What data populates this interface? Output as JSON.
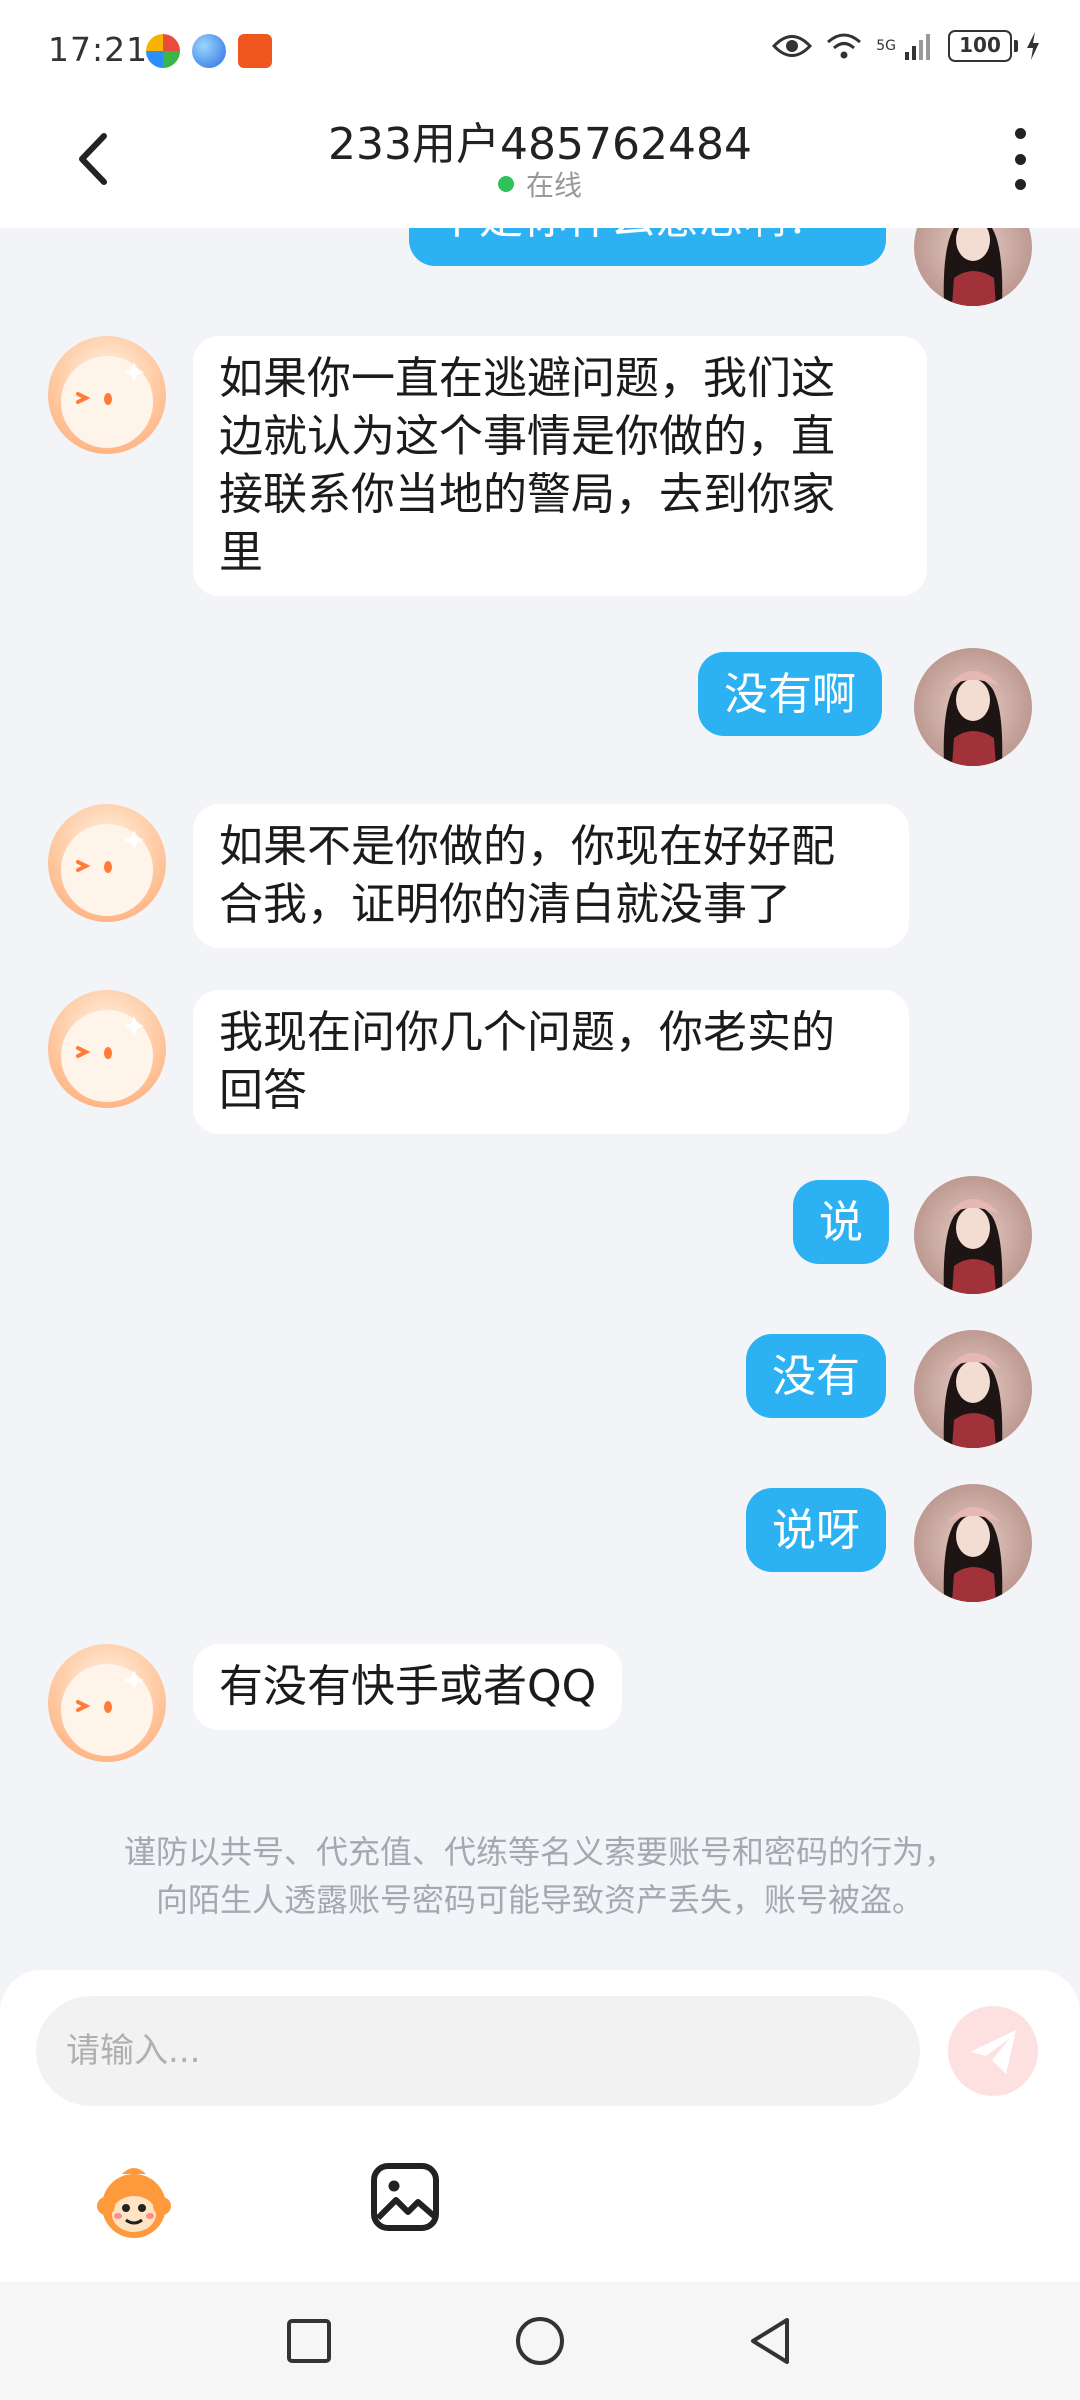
{
  "status_bar": {
    "time": "17:21",
    "network": "5G",
    "battery": "100"
  },
  "header": {
    "title": "233用户485762484",
    "presence": "在线"
  },
  "messages": [
    {
      "sender": "user",
      "text": "不是你什么意思啊？"
    },
    {
      "sender": "other",
      "lines": [
        "如果你一直在逃避问题，我们这",
        "边就认为这个事情是你做的，直",
        "接联系你当地的警局，去到你家",
        "里"
      ]
    },
    {
      "sender": "user",
      "text": "没有啊"
    },
    {
      "sender": "other",
      "lines": [
        "如果不是你做的，你现在好好配",
        "合我，证明你的清白就没事了"
      ]
    },
    {
      "sender": "other",
      "lines": [
        "我现在问你几个问题，你老实的",
        "回答"
      ]
    },
    {
      "sender": "user",
      "text": "说"
    },
    {
      "sender": "user",
      "text": "没有"
    },
    {
      "sender": "user",
      "text": "说呀"
    },
    {
      "sender": "other",
      "text": "有没有快手或者QQ"
    }
  ],
  "notice": {
    "line1": "谨防以共号、代充值、代练等名义索要账号和密码的行为，",
    "line2": "向陌生人透露账号密码可能导致资产丢失，账号被盗。"
  },
  "input": {
    "placeholder": "请输入..."
  },
  "colors": {
    "outgoing_bubble": "#2cb2f3",
    "incoming_bubble": "#ffffff",
    "chat_background": "#f2f4f8",
    "online_dot": "#2fc25b"
  },
  "icons": [
    "back-icon",
    "more-icon",
    "send-icon",
    "emoji-icon",
    "image-icon",
    "recent-apps-icon",
    "home-icon",
    "nav-back-icon"
  ]
}
